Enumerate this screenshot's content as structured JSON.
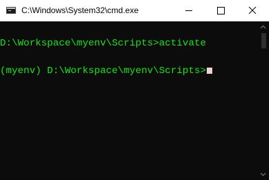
{
  "window": {
    "title": "C:\\Windows\\System32\\cmd.exe",
    "icon": "cmd-console-icon"
  },
  "controls": {
    "minimize_icon": "minimize-icon",
    "maximize_icon": "maximize-icon",
    "close_icon": "close-icon"
  },
  "console": {
    "lines": [
      "D:\\Workspace\\myenv\\Scripts>activate",
      "(myenv) D:\\Workspace\\myenv\\Scripts>"
    ],
    "text_color": "#13e813",
    "background_color": "#0c0c0c"
  }
}
